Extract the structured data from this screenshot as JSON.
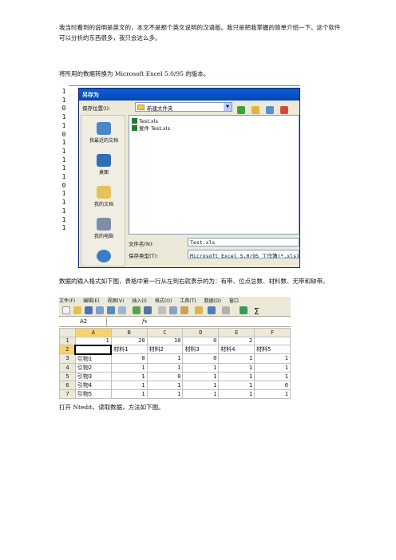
{
  "paragraphs": [
    "我当时看到的说明是英文的，本文不是那个英文说明的汉语版。我只是把我掌握的简单介绍一下。这个软件可以分析的东西很多，我只会这么多。",
    "将所用的数据转换为 Microsoft Excel 5.0/95 的版本。",
    "数据的输入格式如下图，表格中第一行从左到右就表示的为：有带、位点总数、材料数、无带和缺带。",
    "打开 Ntedit，读取数据，方法如下图。"
  ],
  "save_dialog": {
    "left_column_digits": [
      "1",
      "1",
      "0",
      "1",
      "1",
      "0",
      "1",
      "1",
      "1",
      "1",
      "1",
      "0",
      "1",
      "1",
      "1",
      "1",
      "1"
    ],
    "title": "另存为",
    "save_in_label": "保存位置(I):",
    "save_in_value": "新建文件夹",
    "places": [
      "我最近的文档",
      "桌面",
      "我的文档",
      "我的电脑",
      ""
    ],
    "files": [
      "Test.xls",
      "复件 Test.xls"
    ],
    "filename_label": "文件名(N):",
    "filename_value": "Test.xls",
    "filetype_label": "保存类型(T):",
    "filetype_value": "Microsoft Excel 5.0/95 工作簿(*.xls)"
  },
  "excel": {
    "menu": [
      "文件(F)",
      "编辑(E)",
      "视图(V)",
      "插入(I)",
      "格式(O)",
      "工具(T)",
      "数据(D)",
      "窗口"
    ],
    "name_box": "A2",
    "fx_label": "fx",
    "columns": [
      "A",
      "B",
      "C",
      "D",
      "E",
      "F"
    ],
    "rows": [
      {
        "num": "1",
        "cells": [
          "1",
          "20",
          "10",
          "0",
          "2",
          ""
        ]
      },
      {
        "num": "2",
        "cells": [
          "",
          "材料1",
          "材料2",
          "材料3",
          "材料4",
          "材料5"
        ]
      },
      {
        "num": "3",
        "cells": [
          "引物1",
          "0",
          "1",
          "0",
          "1",
          "1"
        ]
      },
      {
        "num": "4",
        "cells": [
          "引物2",
          "1",
          "1",
          "1",
          "1",
          "1"
        ]
      },
      {
        "num": "5",
        "cells": [
          "引物3",
          "1",
          "0",
          "1",
          "1",
          "1"
        ]
      },
      {
        "num": "6",
        "cells": [
          "引物4",
          "1",
          "1",
          "1",
          "1",
          "0"
        ]
      },
      {
        "num": "7",
        "cells": [
          "引物5",
          "1",
          "1",
          "1",
          "1",
          "1"
        ]
      }
    ]
  }
}
